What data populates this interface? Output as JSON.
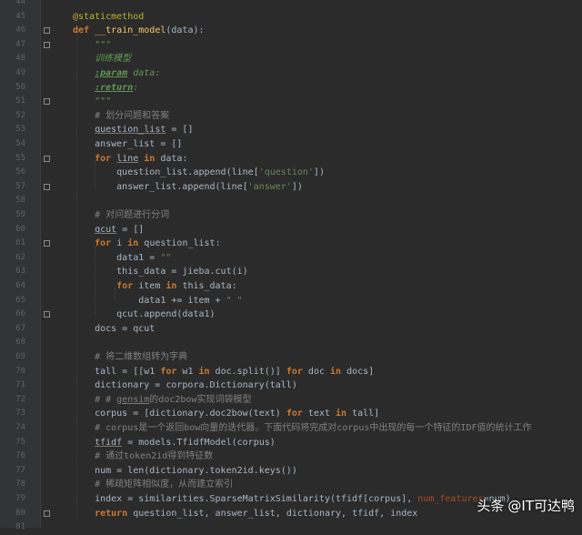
{
  "editor": {
    "lines": [
      {
        "n": "44",
        "t": [
          {
            "s": ""
          }
        ]
      },
      {
        "n": "45",
        "t": [
          {
            "s": "@staticmethod",
            "c": "dec"
          }
        ]
      },
      {
        "n": "46",
        "t": [
          {
            "s": "def ",
            "c": "kw"
          },
          {
            "s": "__train_model",
            "c": "fn"
          },
          {
            "s": "(data):"
          }
        ]
      },
      {
        "n": "47",
        "t": [
          {
            "s": "    \"\"\"",
            "c": "doc"
          }
        ]
      },
      {
        "n": "48",
        "t": [
          {
            "s": "    训练模型",
            "c": "doc"
          }
        ]
      },
      {
        "n": "49",
        "t": [
          {
            "s": "    ",
            "c": "doc"
          },
          {
            "s": ":param",
            "c": "doctag"
          },
          {
            "s": " data:",
            "c": "doc"
          }
        ]
      },
      {
        "n": "50",
        "t": [
          {
            "s": "    ",
            "c": "doc"
          },
          {
            "s": ":return",
            "c": "doctag"
          },
          {
            "s": ":",
            "c": "doc"
          }
        ]
      },
      {
        "n": "51",
        "t": [
          {
            "s": "    \"\"\"",
            "c": "doc"
          }
        ]
      },
      {
        "n": "52",
        "t": [
          {
            "s": "    # 划分问题和答案",
            "c": "cm"
          }
        ]
      },
      {
        "n": "53",
        "t": [
          {
            "s": "    "
          },
          {
            "s": "question_list",
            "c": "ul"
          },
          {
            "s": " = []"
          }
        ]
      },
      {
        "n": "54",
        "t": [
          {
            "s": "    answer_list = []"
          }
        ]
      },
      {
        "n": "55",
        "t": [
          {
            "s": "    "
          },
          {
            "s": "for ",
            "c": "kw"
          },
          {
            "s": "line",
            "c": "ul"
          },
          {
            "s": " in ",
            "c": "kw"
          },
          {
            "s": "data:"
          }
        ]
      },
      {
        "n": "56",
        "t": [
          {
            "s": "        question_list.append(line["
          },
          {
            "s": "'question'",
            "c": "str"
          },
          {
            "s": "])"
          }
        ]
      },
      {
        "n": "57",
        "t": [
          {
            "s": "        answer_list.append(line["
          },
          {
            "s": "'answer'",
            "c": "str"
          },
          {
            "s": "])"
          }
        ]
      },
      {
        "n": "58",
        "t": [
          {
            "s": ""
          }
        ]
      },
      {
        "n": "59",
        "t": [
          {
            "s": "    # 对问题进行分词",
            "c": "cm"
          }
        ]
      },
      {
        "n": "60",
        "t": [
          {
            "s": "    "
          },
          {
            "s": "qcut",
            "c": "ul"
          },
          {
            "s": " = []"
          }
        ]
      },
      {
        "n": "61",
        "t": [
          {
            "s": "    "
          },
          {
            "s": "for ",
            "c": "kw"
          },
          {
            "s": "i "
          },
          {
            "s": "in ",
            "c": "kw"
          },
          {
            "s": "question_list:"
          }
        ]
      },
      {
        "n": "62",
        "t": [
          {
            "s": "        data1 = "
          },
          {
            "s": "\"\"",
            "c": "str"
          }
        ]
      },
      {
        "n": "63",
        "t": [
          {
            "s": "        this_data = jieba.cut(i)"
          }
        ]
      },
      {
        "n": "64",
        "t": [
          {
            "s": "        "
          },
          {
            "s": "for ",
            "c": "kw"
          },
          {
            "s": "item "
          },
          {
            "s": "in ",
            "c": "kw"
          },
          {
            "s": "this_data:"
          }
        ]
      },
      {
        "n": "65",
        "t": [
          {
            "s": "            data1 += item + "
          },
          {
            "s": "\" \"",
            "c": "str"
          }
        ]
      },
      {
        "n": "66",
        "t": [
          {
            "s": "        qcut.append(data1)"
          }
        ]
      },
      {
        "n": "67",
        "t": [
          {
            "s": "    docs = qcut"
          }
        ]
      },
      {
        "n": "68",
        "t": [
          {
            "s": ""
          }
        ]
      },
      {
        "n": "69",
        "t": [
          {
            "s": "    # 将二维数组转为字典",
            "c": "cm"
          }
        ]
      },
      {
        "n": "70",
        "t": [
          {
            "s": "    tall = [[w1 "
          },
          {
            "s": "for ",
            "c": "kw"
          },
          {
            "s": "w1 "
          },
          {
            "s": "in ",
            "c": "kw"
          },
          {
            "s": "doc.split()] "
          },
          {
            "s": "for ",
            "c": "kw"
          },
          {
            "s": "doc "
          },
          {
            "s": "in ",
            "c": "kw"
          },
          {
            "s": "docs]"
          }
        ]
      },
      {
        "n": "71",
        "t": [
          {
            "s": "    dictionary = corpora.Dictionary(tall)"
          }
        ]
      },
      {
        "n": "72",
        "t": [
          {
            "s": "    # # ",
            "c": "cm"
          },
          {
            "s": "gensim",
            "c": "cm ul"
          },
          {
            "s": "的doc2bow实现词袋模型",
            "c": "cm"
          }
        ]
      },
      {
        "n": "73",
        "t": [
          {
            "s": "    corpus = [dictionary.doc2bow(text) "
          },
          {
            "s": "for ",
            "c": "kw"
          },
          {
            "s": "text "
          },
          {
            "s": "in ",
            "c": "kw"
          },
          {
            "s": "tall]"
          }
        ]
      },
      {
        "n": "74",
        "t": [
          {
            "s": "    # corpus是一个返回bow向量的迭代器。下面代码将完成对corpus中出现的每一个特征的IDF值的统计工作",
            "c": "cm"
          }
        ]
      },
      {
        "n": "75",
        "t": [
          {
            "s": "    "
          },
          {
            "s": "tfidf",
            "c": "ul"
          },
          {
            "s": " = models.TfidfModel(corpus)"
          }
        ]
      },
      {
        "n": "76",
        "t": [
          {
            "s": "    # 通过token2id得到特征数",
            "c": "cm"
          }
        ]
      },
      {
        "n": "77",
        "t": [
          {
            "s": "    num = len(dictionary.token2id.keys())"
          }
        ]
      },
      {
        "n": "78",
        "t": [
          {
            "s": "    # 稀疏矩阵相似度，从而建立索引",
            "c": "cm"
          }
        ]
      },
      {
        "n": "79",
        "t": [
          {
            "s": "    index = similarities.SparseMatrixSimilarity(tfidf[corpus], "
          },
          {
            "s": "num_features",
            "c": "param"
          },
          {
            "s": "=num)"
          }
        ]
      },
      {
        "n": "80",
        "t": [
          {
            "s": "    "
          },
          {
            "s": "return ",
            "c": "kw"
          },
          {
            "s": "question_list, answer_list, dictionary, tfidf, index"
          }
        ]
      },
      {
        "n": "81",
        "t": [
          {
            "s": ""
          }
        ]
      }
    ],
    "fold_markers": [
      "46",
      "47",
      "51",
      "55",
      "57",
      "61",
      "66",
      "80"
    ]
  },
  "watermark": {
    "prefix": "头条",
    "handle": "@IT可达鸭"
  }
}
